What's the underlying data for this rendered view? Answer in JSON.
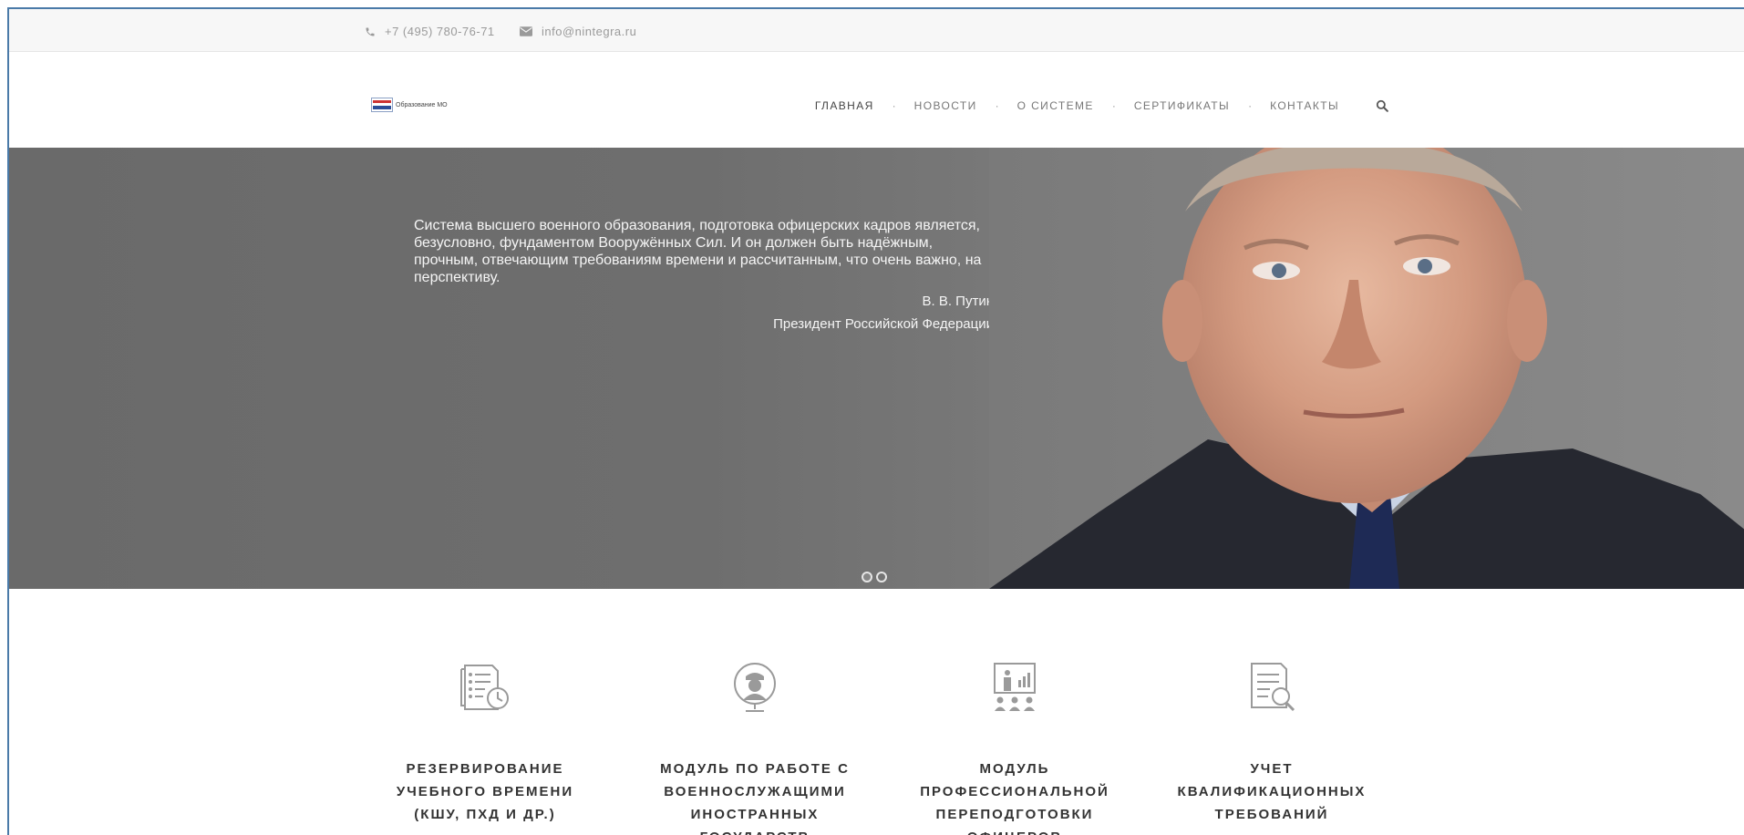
{
  "topbar": {
    "phone": "+7 (495) 780-76-71",
    "email": "info@nintegra.ru",
    "phone_icon": "phone-icon",
    "email_icon": "envelope-icon"
  },
  "logo": {
    "text": "Образование МО"
  },
  "nav": {
    "items": [
      {
        "label": "ГЛАВНАЯ"
      },
      {
        "label": "НОВОСТИ"
      },
      {
        "label": "О СИСТЕМЕ"
      },
      {
        "label": "СЕРТИФИКАТЫ"
      },
      {
        "label": "КОНТАКТЫ"
      }
    ],
    "separator": "·",
    "search_icon": "search-icon"
  },
  "hero": {
    "quote": "Система высшего военного образования, подготовка офицерских кадров является, безусловно, фундаментом Вооружённых Сил. И он должен быть надёжным, прочным, отвечающим требованиям времени и рассчитанным, что очень важно, на перспективу.",
    "author": "В. В. Путин",
    "role": "Президент Российской Федерации",
    "slides": 2,
    "active_slide": 1
  },
  "features": [
    {
      "title": "РЕЗЕРВИРОВАНИЕ УЧЕБНОГО ВРЕМЕНИ (КШУ, ПХД И ДР.)",
      "icon": "schedule-icon"
    },
    {
      "title": "МОДУЛЬ ПО РАБОТЕ С ВОЕННОСЛУЖАЩИМИ ИНОСТРАННЫХ ГОСУДАРСТВ",
      "icon": "globe-soldier-icon"
    },
    {
      "title": "МОДУЛЬ ПРОФЕССИОНАЛЬНОЙ ПЕРЕПОДГОТОВКИ ОФИЦЕРОВ",
      "icon": "presentation-icon"
    },
    {
      "title": "УЧЕТ КВАЛИФИКАЦИОННЫХ ТРЕБОВАНИЙ",
      "icon": "document-search-icon"
    }
  ],
  "colors": {
    "frame_border": "#4a7aa8",
    "hero_bg": "#6e6e6e",
    "nav_text": "#777777",
    "icon_gray": "#9a9a9a"
  }
}
